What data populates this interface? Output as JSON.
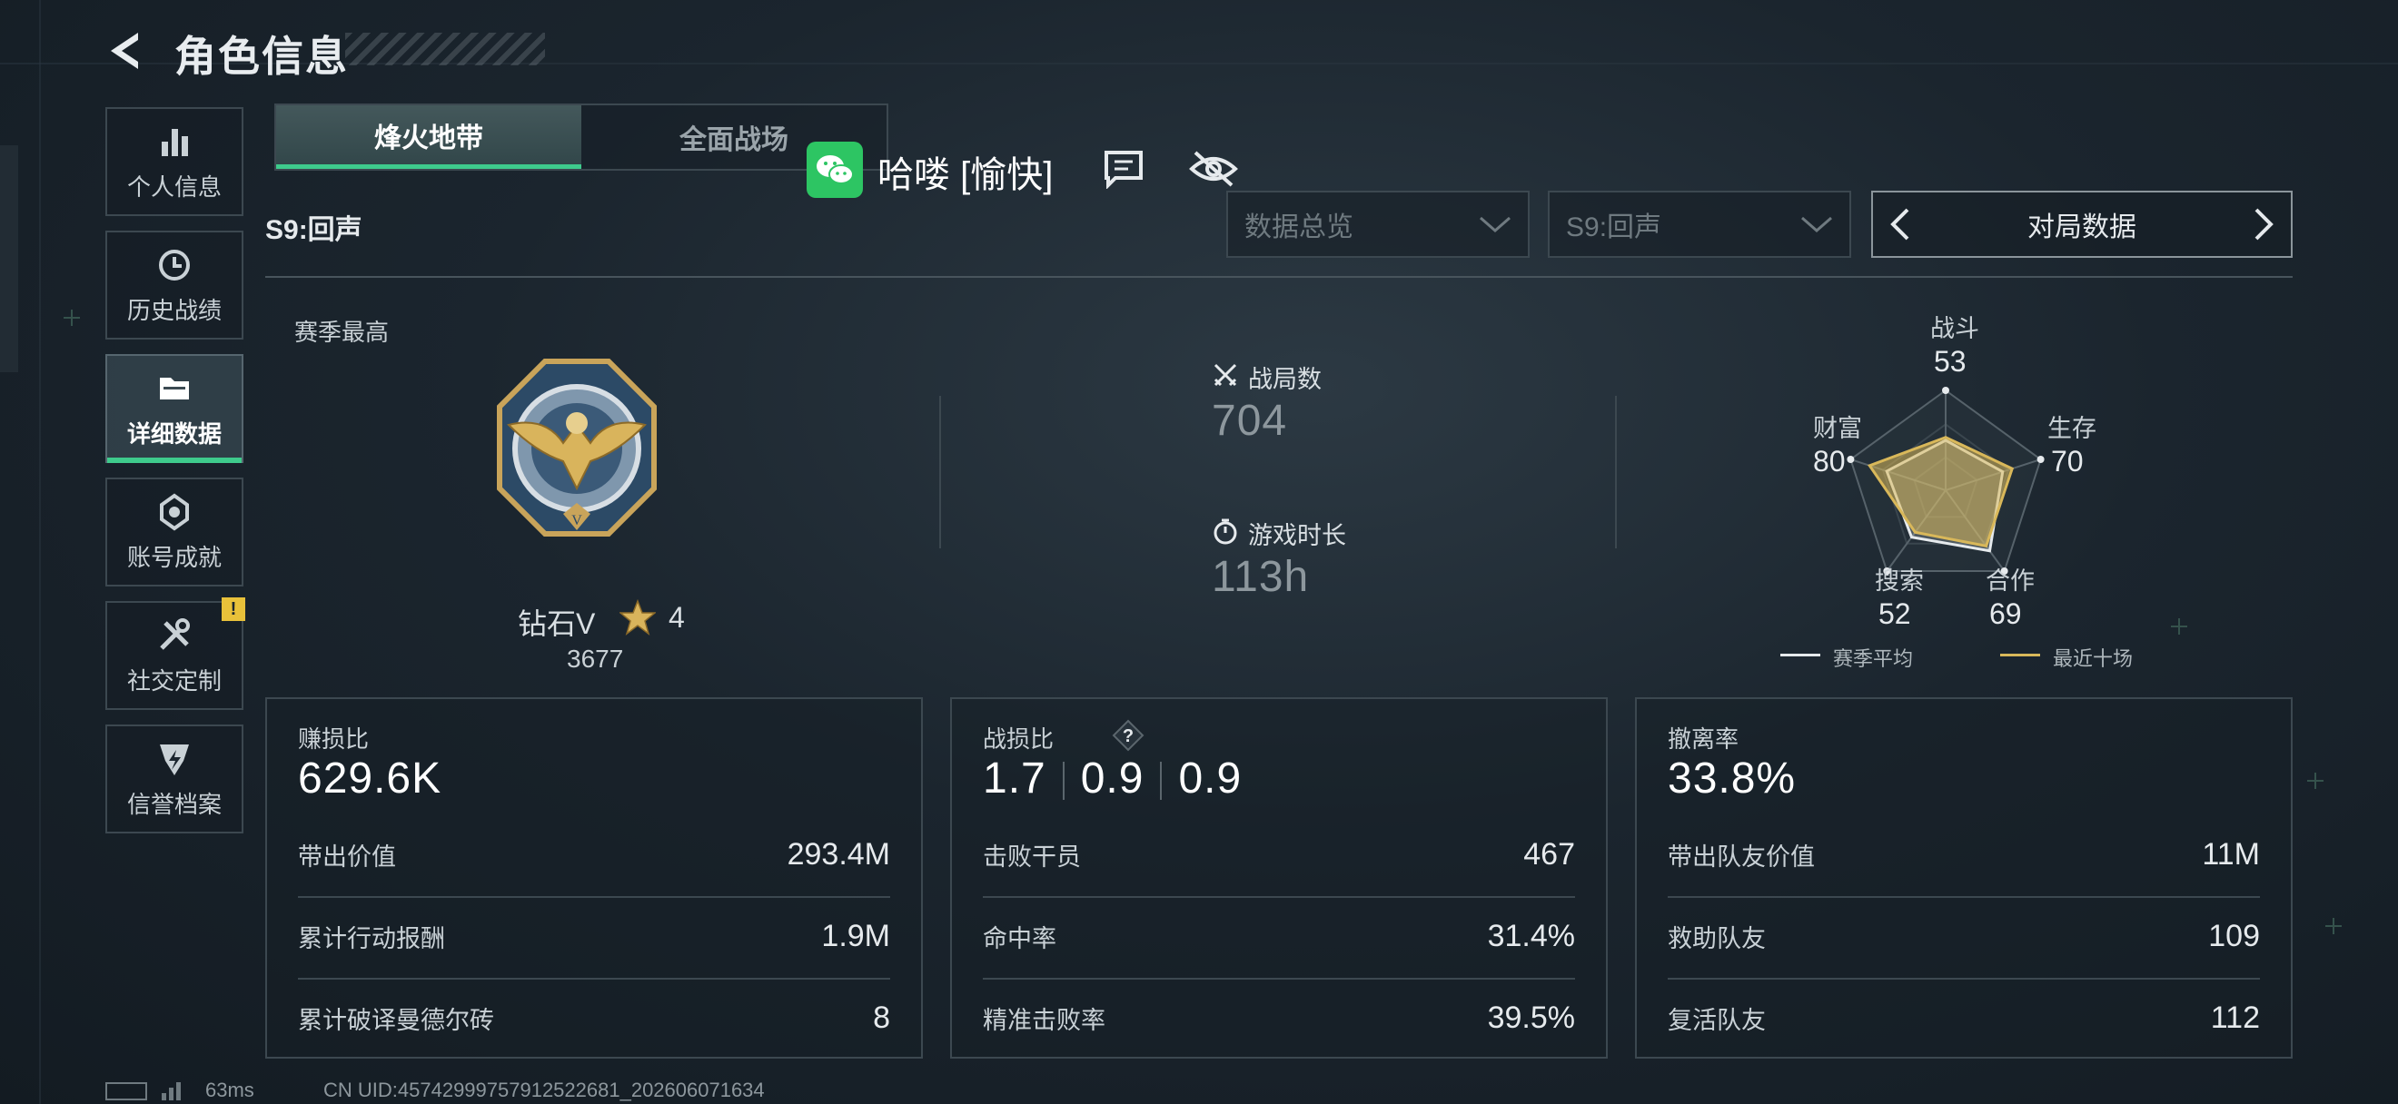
{
  "header": {
    "title": "角色信息"
  },
  "sidebar": {
    "items": [
      {
        "label": "个人信息",
        "icon": "bar-chart-icon"
      },
      {
        "label": "历史战绩",
        "icon": "history-clock-icon"
      },
      {
        "label": "详细数据",
        "icon": "folder-icon",
        "active": true
      },
      {
        "label": "账号成就",
        "icon": "achievement-icon"
      },
      {
        "label": "社交定制",
        "icon": "tools-icon",
        "badge": "!"
      },
      {
        "label": "信誉档案",
        "icon": "credit-shield-icon"
      }
    ]
  },
  "tabs": [
    {
      "label": "烽火地带",
      "active": true
    },
    {
      "label": "全面战场",
      "active": false
    }
  ],
  "player": {
    "name": "哈喽 [愉快]"
  },
  "season_label": "S9:回声",
  "filters": {
    "overview": "数据总览",
    "season": "S9:回声",
    "nav_label": "对局数据"
  },
  "overview": {
    "rank_caption": "赛季最高",
    "rank_name": "钻石V",
    "rank_stars": "4",
    "rank_score": "3677",
    "matches_label": "战局数",
    "matches_value": "704",
    "playtime_label": "游戏时长",
    "playtime_value": "113h"
  },
  "radar": {
    "labels": {
      "combat": "战斗",
      "survival": "生存",
      "teamwork": "合作",
      "search": "搜索",
      "wealth": "财富"
    },
    "values": {
      "combat": "53",
      "survival": "70",
      "teamwork": "69",
      "search": "52",
      "wealth": "80"
    },
    "recent_ten": {
      "combat": 53,
      "survival": 70,
      "teamwork": 69,
      "search": 52,
      "wealth": 80
    },
    "season_avg": {
      "combat": 50,
      "survival": 60,
      "teamwork": 75,
      "search": 58,
      "wealth": 62
    },
    "legend_season": "赛季平均",
    "legend_recent": "最近十场",
    "colors": {
      "season": "#e6eaed",
      "recent": "#d9b85a"
    }
  },
  "panels": {
    "profit": {
      "title": "赚损比",
      "big": "629.6K",
      "rows": [
        {
          "label": "带出价值",
          "value": "293.4M"
        },
        {
          "label": "累计行动报酬",
          "value": "1.9M"
        },
        {
          "label": "累计破译曼德尔砖",
          "value": "8"
        }
      ]
    },
    "kd": {
      "title": "战损比",
      "help": "?",
      "values": [
        "1.7",
        "0.9",
        "0.9"
      ],
      "rows": [
        {
          "label": "击败干员",
          "value": "467"
        },
        {
          "label": "命中率",
          "value": "31.4%"
        },
        {
          "label": "精准击败率",
          "value": "39.5%"
        }
      ]
    },
    "extract": {
      "title": "撤离率",
      "big": "33.8%",
      "rows": [
        {
          "label": "带出队友价值",
          "value": "11M"
        },
        {
          "label": "救助队友",
          "value": "109"
        },
        {
          "label": "复活队友",
          "value": "112"
        }
      ]
    }
  },
  "footer": {
    "ping": "63ms",
    "uid": "CN UID:45742999757912522681_202606071634"
  }
}
